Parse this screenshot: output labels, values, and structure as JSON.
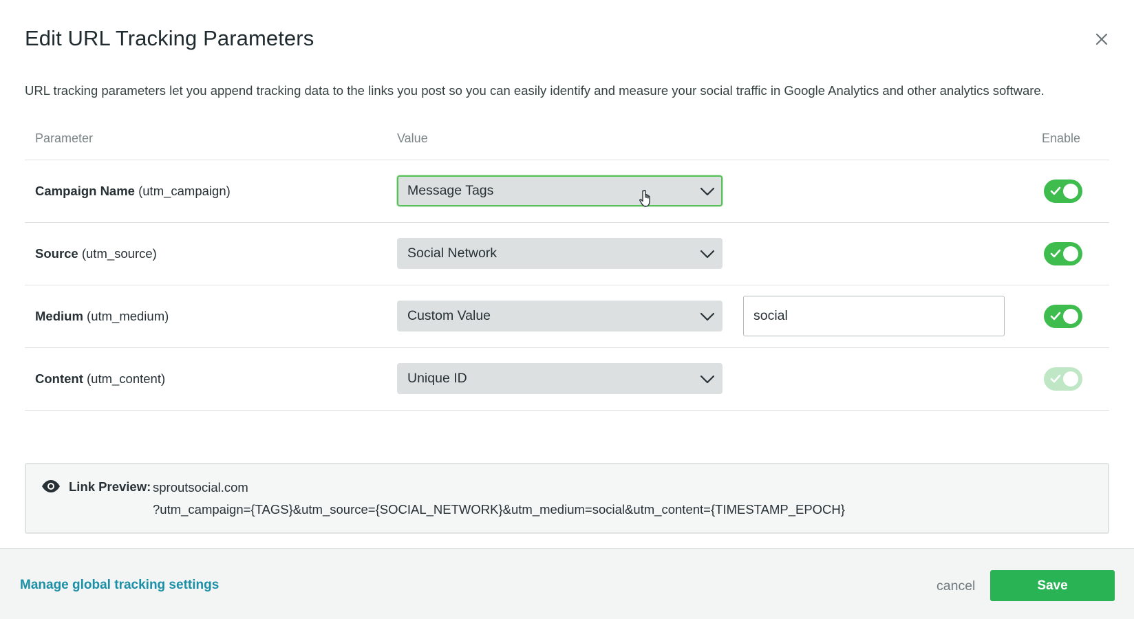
{
  "modal": {
    "title": "Edit URL Tracking Parameters",
    "intro": "URL tracking parameters let you append tracking data to the links you post so you can easily identify and measure your social traffic in Google Analytics and other analytics software."
  },
  "table": {
    "headers": {
      "parameter": "Parameter",
      "value": "Value",
      "enable": "Enable"
    },
    "rows": [
      {
        "name": "Campaign Name",
        "key": "(utm_campaign)",
        "value": "Message Tags",
        "enabled": true
      },
      {
        "name": "Source",
        "key": "(utm_source)",
        "value": "Social Network",
        "enabled": true
      },
      {
        "name": "Medium",
        "key": "(utm_medium)",
        "value": "Custom Value",
        "custom_value": "social",
        "enabled": true
      },
      {
        "name": "Content",
        "key": "(utm_content)",
        "value": "Unique ID",
        "enabled": true,
        "disabled_look": true
      }
    ]
  },
  "preview": {
    "label": "Link Preview:",
    "domain": "sproutsocial.com",
    "query": "?utm_campaign={TAGS}&utm_source={SOCIAL_NETWORK}&utm_medium=social&utm_content={TIMESTAMP_EPOCH}"
  },
  "footer": {
    "manage_link": "Manage global tracking settings",
    "cancel": "cancel",
    "save": "Save"
  },
  "colors": {
    "accent_green": "#2ab354",
    "toggle_on": "#3ebd4e",
    "link": "#1a8fa6",
    "focus": "#59c15a"
  },
  "icons": [
    "close-icon",
    "chevron-down-icon",
    "check-icon",
    "eye-icon",
    "hand-cursor-icon"
  ]
}
